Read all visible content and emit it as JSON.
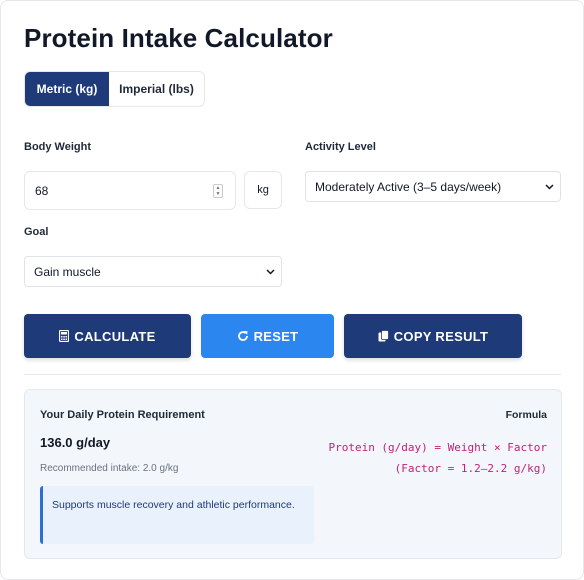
{
  "page": {
    "title": "Protein Intake Calculator"
  },
  "units": {
    "metric_label": "Metric (kg)",
    "imperial_label": "Imperial (lbs)",
    "selected": "metric"
  },
  "weight": {
    "label": "Body Weight",
    "value": "68",
    "unit": "kg"
  },
  "activity": {
    "label": "Activity Level",
    "selected": "Moderately Active (3–5 days/week)"
  },
  "goal": {
    "label": "Goal",
    "selected": "Gain muscle"
  },
  "buttons": {
    "calculate": "CALCULATE",
    "reset": "RESET",
    "copy": "COPY RESULT"
  },
  "icons": {
    "calculate": "calculator-icon",
    "reset": "refresh-icon",
    "copy": "copy-icon"
  },
  "result": {
    "heading": "Your Daily Protein Requirement",
    "value": "136.0 g/day",
    "recommendation": "Recommended intake: 2.0 g/kg",
    "note": "Supports muscle recovery and athletic performance.",
    "formula_heading": "Formula",
    "formula_line1": "Protein (g/day) = Weight × Factor",
    "formula_line2": "(Factor = 1.2–2.2 g/kg)"
  },
  "colors": {
    "primary": "#1e3a78",
    "accent": "#2b86f0",
    "formula": "#c4207a"
  }
}
